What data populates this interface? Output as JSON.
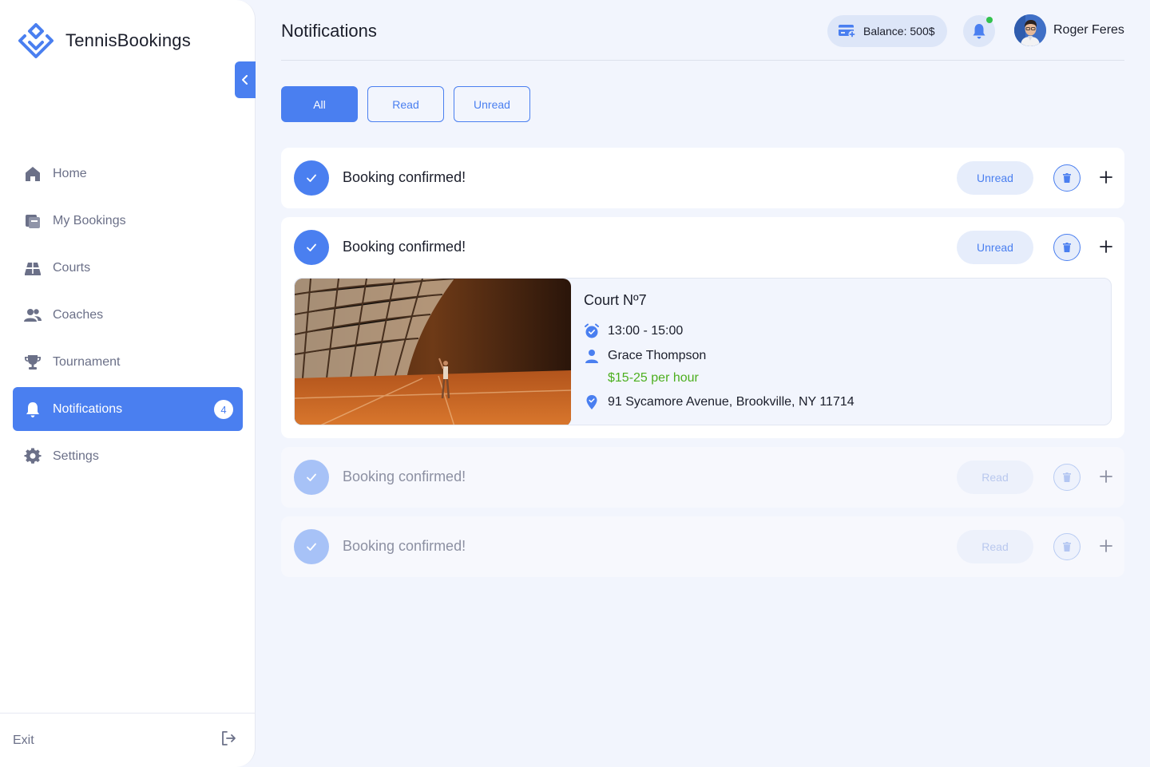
{
  "app": {
    "brand": "TennisBookings"
  },
  "sidebar": {
    "items": [
      {
        "label": "Home",
        "icon": "home-icon"
      },
      {
        "label": "My Bookings",
        "icon": "bookings-icon"
      },
      {
        "label": "Courts",
        "icon": "court-icon"
      },
      {
        "label": "Coaches",
        "icon": "coaches-icon"
      },
      {
        "label": "Tournament",
        "icon": "trophy-icon"
      },
      {
        "label": "Notifications",
        "icon": "bell-icon",
        "badge": "4",
        "active": true
      },
      {
        "label": "Settings",
        "icon": "gear-icon"
      }
    ],
    "exit_label": "Exit"
  },
  "header": {
    "title": "Notifications",
    "balance": "Balance: 500$",
    "user_name": "Roger Feres",
    "notification_dot": true
  },
  "filters": {
    "all": "All",
    "read": "Read",
    "unread": "Unread",
    "active": "All"
  },
  "notifications": [
    {
      "title": "Booking confirmed!",
      "status": "Unread",
      "expanded": false
    },
    {
      "title": "Booking confirmed!",
      "status": "Unread",
      "expanded": true,
      "details": {
        "court": "Court Nº7",
        "time": "13:00 - 15:00",
        "coach": "Grace Thompson",
        "price": "$15-25 per hour",
        "address": "91 Sycamore Avenue, Brookville, NY 11714"
      }
    },
    {
      "title": "Booking confirmed!",
      "status": "Read",
      "expanded": false
    },
    {
      "title": "Booking confirmed!",
      "status": "Read",
      "expanded": false
    }
  ],
  "colors": {
    "accent": "#4a7ff0",
    "background": "#f2f5fd",
    "price": "#4caf1f",
    "online": "#33c24d"
  }
}
